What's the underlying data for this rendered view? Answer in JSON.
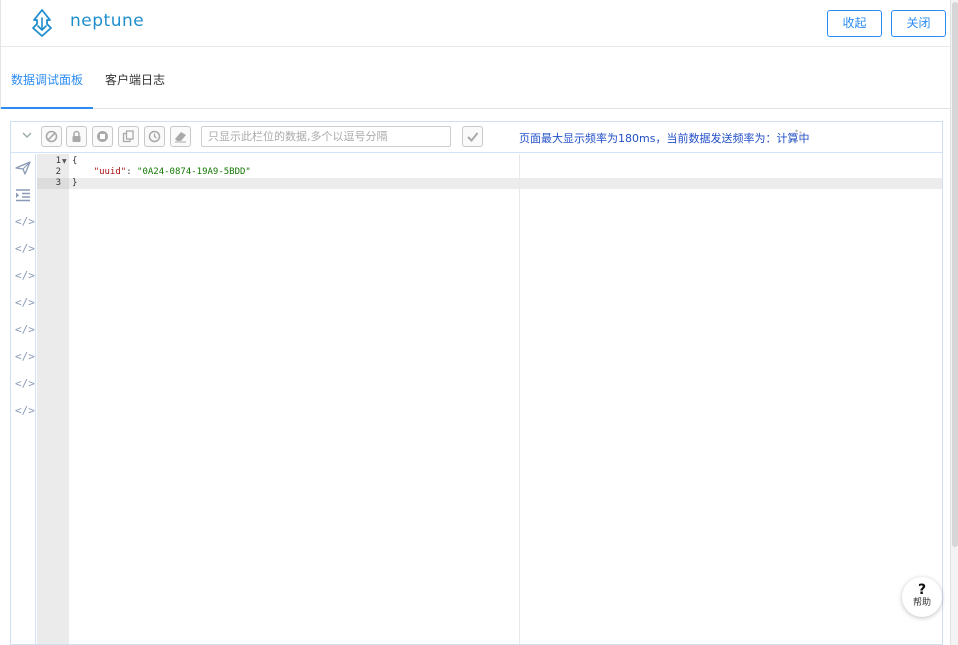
{
  "header": {
    "brand": "neptune",
    "collapse_label": "收起",
    "close_label": "关闭"
  },
  "tabs": [
    {
      "label": "数据调试面板",
      "active": true
    },
    {
      "label": "客户端日志",
      "active": false
    }
  ],
  "toolbar": {
    "filter_placeholder": "只显示此栏位的数据,多个以逗号分隔",
    "rate_text": "页面最大显示频率为180ms，当前数据发送频率为：计算中"
  },
  "editor": {
    "line_numbers": [
      "1",
      "2",
      "3"
    ],
    "lines": [
      "{",
      "    \"uuid\": \"0A24-0874-19A9-5BDD\"",
      "}"
    ],
    "key": "\"uuid\"",
    "value": "\"0A24-0874-19A9-5BDD\""
  },
  "help": {
    "icon": "?",
    "label": "帮助"
  },
  "colors": {
    "accent": "#2d8cf0",
    "rate_text": "#2450c8"
  }
}
